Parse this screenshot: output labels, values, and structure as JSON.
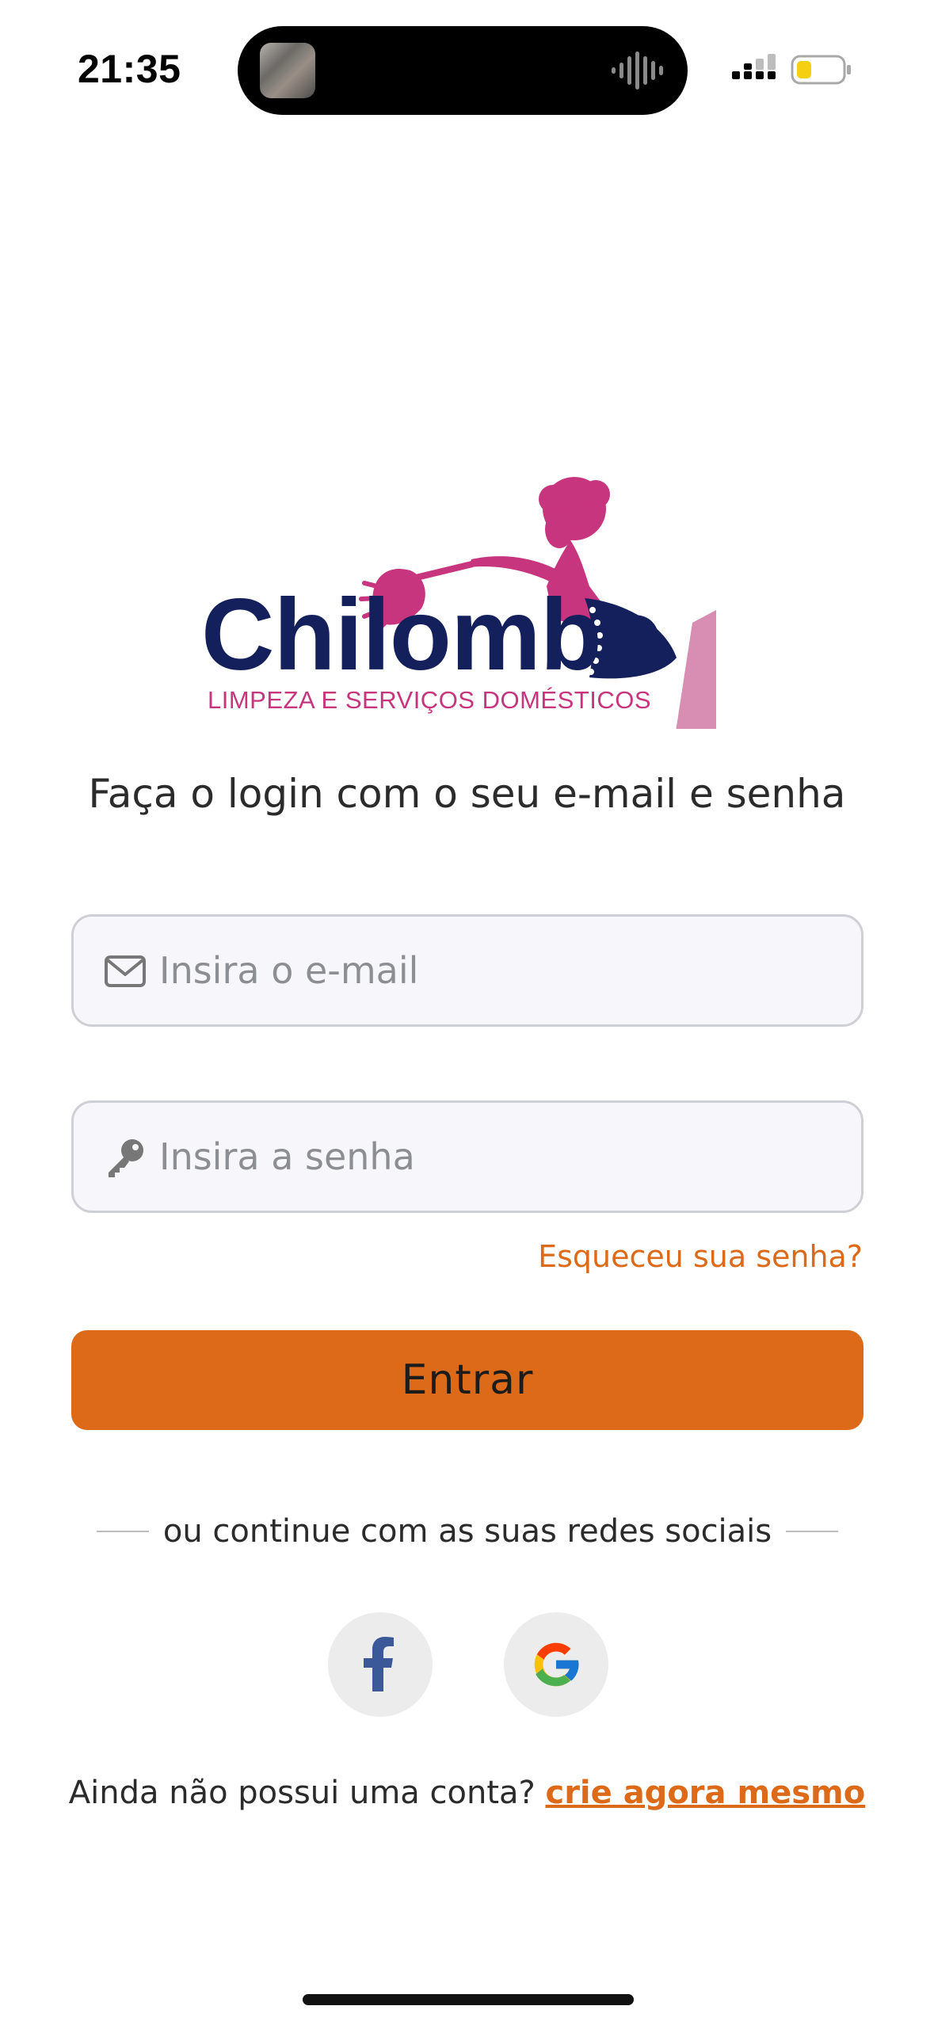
{
  "status_bar": {
    "time": "21:35"
  },
  "logo": {
    "wordmark": "Chilombo",
    "tagline": "LIMPEZA E SERVIÇOS DOMÉSTICOS"
  },
  "headline": "Faça o login com o seu e-mail e senha",
  "email_field": {
    "placeholder": "Insira o e-mail",
    "value": "",
    "icon": "mail-icon"
  },
  "password_field": {
    "placeholder": "Insira a senha",
    "value": "",
    "icon": "key-icon"
  },
  "forgot_password": "Esqueceu sua senha?",
  "login_button": "Entrar",
  "divider_text": "ou continue com as suas redes sociais",
  "social": {
    "facebook_icon": "facebook-icon",
    "google_icon": "google-icon"
  },
  "signup": {
    "prompt": "Ainda não possui uma conta?",
    "link": "crie agora mesmo"
  },
  "colors": {
    "accent": "#dc6a19",
    "brand_navy": "#13205c",
    "brand_pink": "#c8357f",
    "field_background": "#f7f7fb",
    "social_button_background": "#ececec"
  }
}
